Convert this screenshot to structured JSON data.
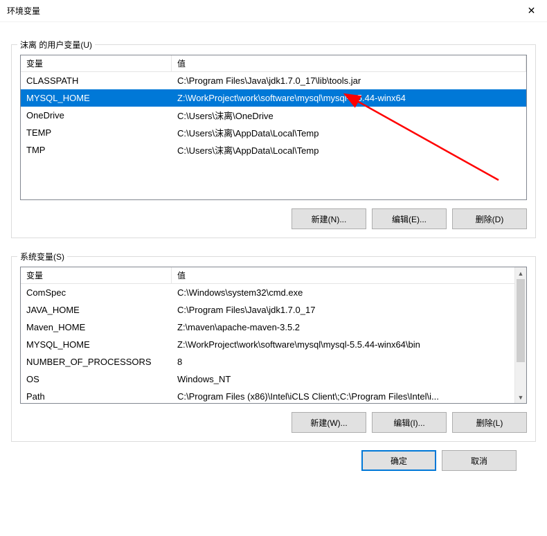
{
  "window": {
    "title": "环境变量",
    "close_glyph": "✕"
  },
  "user_vars": {
    "legend": "沫离 的用户变量(U)",
    "headers": {
      "var": "变量",
      "val": "值"
    },
    "rows": [
      {
        "var": "CLASSPATH",
        "val": "C:\\Program Files\\Java\\jdk1.7.0_17\\lib\\tools.jar",
        "selected": false
      },
      {
        "var": "MYSQL_HOME",
        "val": "Z:\\WorkProject\\work\\software\\mysql\\mysql-5.5.44-winx64",
        "selected": true
      },
      {
        "var": "OneDrive",
        "val": "C:\\Users\\沫离\\OneDrive",
        "selected": false
      },
      {
        "var": "TEMP",
        "val": "C:\\Users\\沫离\\AppData\\Local\\Temp",
        "selected": false
      },
      {
        "var": "TMP",
        "val": "C:\\Users\\沫离\\AppData\\Local\\Temp",
        "selected": false
      }
    ],
    "buttons": {
      "new": "新建(N)...",
      "edit": "编辑(E)...",
      "delete": "删除(D)"
    }
  },
  "sys_vars": {
    "legend": "系统变量(S)",
    "headers": {
      "var": "变量",
      "val": "值"
    },
    "rows": [
      {
        "var": "ComSpec",
        "val": "C:\\Windows\\system32\\cmd.exe"
      },
      {
        "var": "JAVA_HOME",
        "val": "C:\\Program Files\\Java\\jdk1.7.0_17"
      },
      {
        "var": "Maven_HOME",
        "val": "Z:\\maven\\apache-maven-3.5.2"
      },
      {
        "var": "MYSQL_HOME",
        "val": "Z:\\WorkProject\\work\\software\\mysql\\mysql-5.5.44-winx64\\bin"
      },
      {
        "var": "NUMBER_OF_PROCESSORS",
        "val": "8"
      },
      {
        "var": "OS",
        "val": "Windows_NT"
      },
      {
        "var": "Path",
        "val": "C:\\Program Files (x86)\\Intel\\iCLS Client\\;C:\\Program Files\\Intel\\i..."
      }
    ],
    "buttons": {
      "new": "新建(W)...",
      "edit": "编辑(I)...",
      "delete": "删除(L)"
    }
  },
  "footer": {
    "ok": "确定",
    "cancel": "取消"
  },
  "annotation": {
    "arrow_color": "#ff0000"
  }
}
